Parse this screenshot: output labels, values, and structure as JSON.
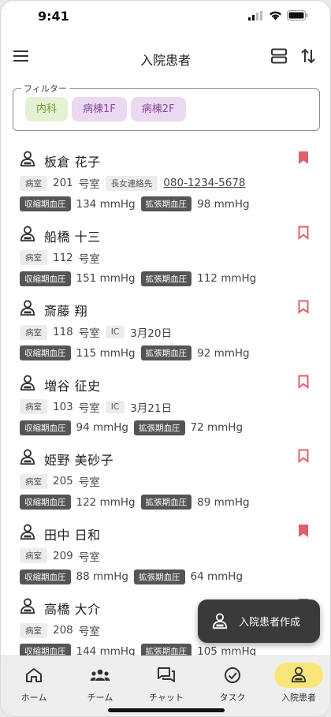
{
  "status": {
    "time": "9:41"
  },
  "header": {
    "title": "入院患者"
  },
  "filter": {
    "legend": "フィルター",
    "chips": [
      {
        "label": "内科",
        "color": "#e4f1d3"
      },
      {
        "label": "病棟1F",
        "color": "#ead9f0"
      },
      {
        "label": "病棟2F",
        "color": "#ead9f0"
      }
    ]
  },
  "labels": {
    "room": "病室",
    "room_suffix": "号室",
    "contact": "長女連絡先",
    "ic": "IC",
    "sys": "収縮期血圧",
    "dia": "拡張期血圧",
    "unit": "mmHg"
  },
  "patients": [
    {
      "name": "板倉 花子",
      "room": "201",
      "contact": "080-1234-5678",
      "sys": "134",
      "dia": "98",
      "bookmarked": true
    },
    {
      "name": "船橋 十三",
      "room": "112",
      "sys": "151",
      "dia": "112",
      "bookmarked": false
    },
    {
      "name": "斎藤 翔",
      "room": "118",
      "ic": "3月20日",
      "sys": "115",
      "dia": "92",
      "bookmarked": false
    },
    {
      "name": "増谷 征史",
      "room": "103",
      "ic": "3月21日",
      "sys": "94",
      "dia": "72",
      "bookmarked": false
    },
    {
      "name": "姫野 美砂子",
      "room": "205",
      "sys": "122",
      "dia": "89",
      "bookmarked": false
    },
    {
      "name": "田中 日和",
      "room": "209",
      "sys": "88",
      "dia": "64",
      "bookmarked": true
    },
    {
      "name": "高橋 大介",
      "room": "208",
      "sys": "144",
      "dia": "105",
      "bookmarked": true
    }
  ],
  "fab": {
    "label": "入院患者作成"
  },
  "nav": [
    {
      "label": "ホーム",
      "icon": "home-icon"
    },
    {
      "label": "チーム",
      "icon": "team-icon"
    },
    {
      "label": "チャット",
      "icon": "chat-icon"
    },
    {
      "label": "タスク",
      "icon": "task-icon"
    },
    {
      "label": "入院患者",
      "icon": "patient-icon",
      "active": true
    }
  ],
  "colors": {
    "accent": "#f8e57a",
    "bookmark": "#e0606a"
  }
}
